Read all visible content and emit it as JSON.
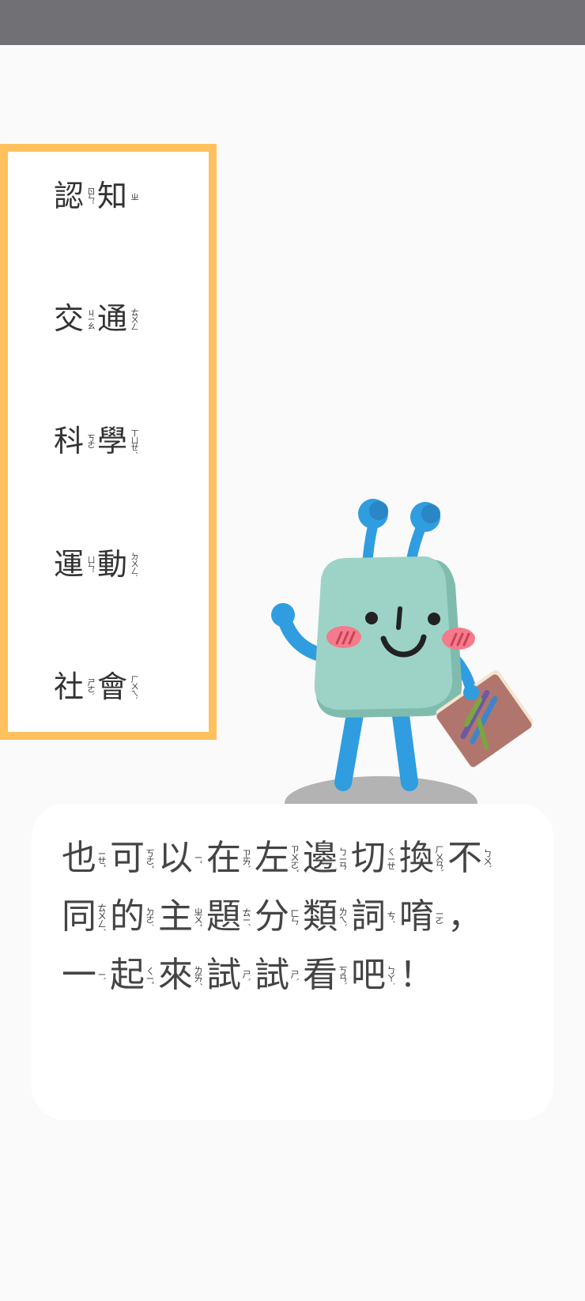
{
  "menu": {
    "items": [
      {
        "chars": [
          {
            "c": "認",
            "z": "ㄖㄣˋ"
          },
          {
            "c": "知",
            "z": "ㄓ"
          }
        ]
      },
      {
        "chars": [
          {
            "c": "交",
            "z": "ㄐㄧㄠ"
          },
          {
            "c": "通",
            "z": "ㄊㄨㄥ"
          }
        ]
      },
      {
        "chars": [
          {
            "c": "科",
            "z": "ㄎㄜ"
          },
          {
            "c": "學",
            "z": "ㄒㄩㄝˊ"
          }
        ]
      },
      {
        "chars": [
          {
            "c": "運",
            "z": "ㄩㄣˋ"
          },
          {
            "c": "動",
            "z": "ㄉㄨㄥˋ"
          }
        ]
      },
      {
        "chars": [
          {
            "c": "社",
            "z": "ㄕㄜˋ"
          },
          {
            "c": "會",
            "z": "ㄏㄨㄟˋ"
          }
        ]
      }
    ]
  },
  "dialog": {
    "chars": [
      {
        "c": "也",
        "z": "ㄧㄝˇ"
      },
      {
        "c": "可",
        "z": "ㄎㄜˇ"
      },
      {
        "c": "以",
        "z": "ㄧˇ"
      },
      {
        "c": "在",
        "z": "ㄗㄞˋ"
      },
      {
        "c": "左",
        "z": "ㄗㄨㄛˇ"
      },
      {
        "c": "邊",
        "z": "ㄅㄧㄢ"
      },
      {
        "c": "切",
        "z": "ㄑㄧㄝ"
      },
      {
        "c": "換",
        "z": "ㄏㄨㄢˋ"
      },
      {
        "c": "不",
        "z": "ㄅㄨˋ"
      },
      {
        "c": "同",
        "z": "ㄊㄨㄥˊ"
      },
      {
        "c": "的",
        "z": "ㄉㄜ˙"
      },
      {
        "c": "主",
        "z": "ㄓㄨˇ"
      },
      {
        "c": "題",
        "z": "ㄊㄧˊ"
      },
      {
        "c": "分",
        "z": "ㄈㄣ"
      },
      {
        "c": "類",
        "z": "ㄌㄟˋ"
      },
      {
        "c": "詞",
        "z": "ㄘˊ"
      },
      {
        "c": "唷",
        "z": "ㄧㄛ"
      },
      {
        "c": "，",
        "z": "",
        "p": true
      },
      {
        "c": "一",
        "z": "ㄧˋ"
      },
      {
        "c": "起",
        "z": "ㄑㄧˇ"
      },
      {
        "c": "來",
        "z": "ㄌㄞˊ"
      },
      {
        "c": "試",
        "z": "ㄕˋ"
      },
      {
        "c": "試",
        "z": "ㄕˋ"
      },
      {
        "c": "看",
        "z": "ㄎㄢˋ"
      },
      {
        "c": "吧",
        "z": "ㄅㄚ˙"
      },
      {
        "c": "！",
        "z": "",
        "p": true
      }
    ]
  },
  "colors": {
    "status_bar": "#707075",
    "menu_border": "#ffc15e",
    "mascot_body": "#9dd3c6",
    "mascot_limbs": "#2f9de0",
    "cheeks": "#f47b8c",
    "book": "#b0766e"
  },
  "mascot": {
    "icon": "alien-mascot-holding-book"
  }
}
